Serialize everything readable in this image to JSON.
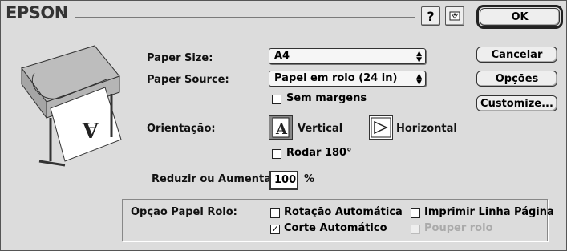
{
  "header": {
    "brand": "EPSON"
  },
  "icons": {
    "help": "help-icon",
    "utility": "utility-icon"
  },
  "buttons": {
    "ok": "OK",
    "cancel": "Cancelar",
    "options": "Opções",
    "customize": "Customize..."
  },
  "paper_size": {
    "label": "Paper Size:",
    "value": "A4"
  },
  "paper_source": {
    "label": "Paper Source:",
    "value": "Papel em rolo (24 in)"
  },
  "borderless": {
    "label": "Sem margens",
    "checked": false
  },
  "orientation": {
    "label": "Orientação:",
    "portrait_label": "Vertical",
    "landscape_label": "Horizontal",
    "selected": "Vertical",
    "rotate_label": "Rodar 180°",
    "rotate_checked": false
  },
  "scale": {
    "label": "Reduzir ou Aumentar:",
    "value": "100",
    "unit": "%"
  },
  "roll_options": {
    "label": "Opçao Papel Rolo:",
    "auto_rotate": {
      "label": "Rotação Automática",
      "checked": false
    },
    "print_page_line": {
      "label": "Imprimir Linha Página",
      "checked": false
    },
    "auto_cut": {
      "label": "Corte Automático",
      "checked": true
    },
    "save_roll": {
      "label": "Pouper rolo",
      "checked": false,
      "disabled": true
    }
  },
  "preview_glyph": "A"
}
